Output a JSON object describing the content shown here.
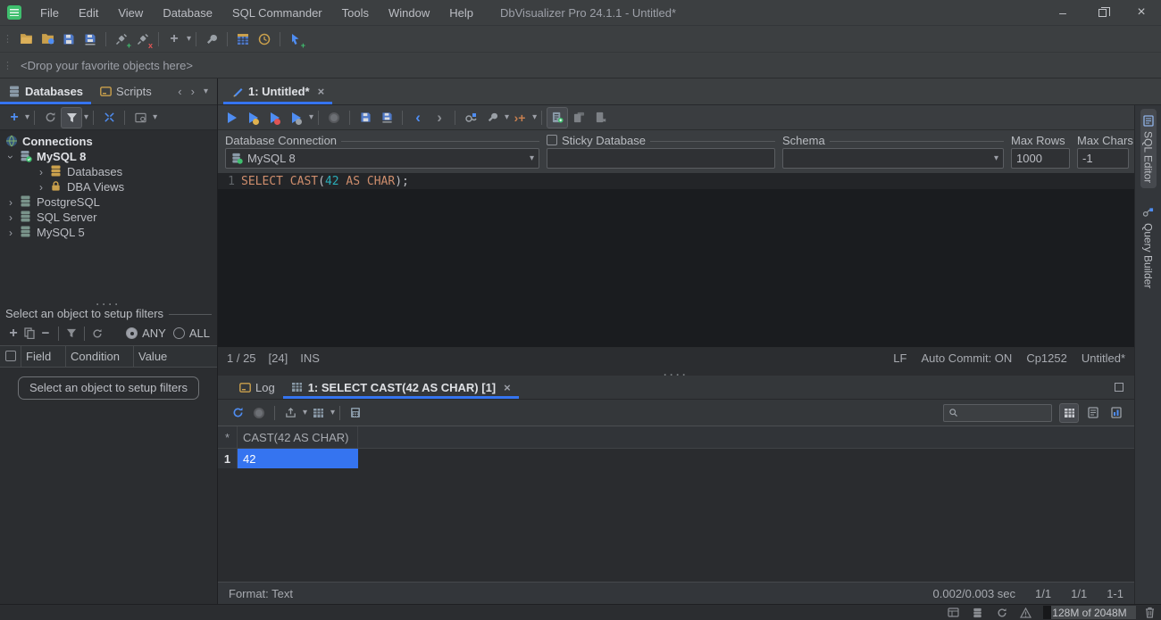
{
  "window": {
    "title": "DbVisualizer Pro 24.1.1 - Untitled*"
  },
  "menu": {
    "items": [
      "File",
      "Edit",
      "View",
      "Database",
      "SQL Commander",
      "Tools",
      "Window",
      "Help"
    ]
  },
  "favorites": {
    "placeholder": "<Drop your favorite objects here>"
  },
  "sidebar": {
    "tabs": {
      "databases": "Databases",
      "scripts": "Scripts"
    },
    "tree": {
      "root": "Connections",
      "mysql8": "MySQL 8",
      "databases": "Databases",
      "dba_views": "DBA Views",
      "postgresql": "PostgreSQL",
      "sqlserver": "SQL Server",
      "mysql5": "MySQL 5"
    },
    "filters": {
      "header": "Select an object to setup filters",
      "any": "ANY",
      "all": "ALL",
      "col_field": "Field",
      "col_condition": "Condition",
      "col_value": "Value",
      "button": "Select an object to setup filters"
    }
  },
  "editor": {
    "tab": "1: Untitled*",
    "connection": {
      "label": "Database Connection",
      "value": "MySQL 8"
    },
    "sticky": {
      "label": "Sticky Database"
    },
    "schema": {
      "label": "Schema"
    },
    "max_rows": {
      "label": "Max Rows",
      "value": "1000"
    },
    "max_chars": {
      "label": "Max Chars",
      "value": "-1"
    },
    "gutter": {
      "line1": "1"
    },
    "sql": {
      "kw1": "SELECT ",
      "fn": "CAST",
      "p1": "(",
      "num": "42",
      "kw2": " AS ",
      "kw3": "CHAR",
      "p2": ");"
    },
    "status": {
      "caret": "1 / 25",
      "sel": "[24]",
      "mode": "INS",
      "eol": "LF",
      "autocommit": "Auto Commit: ON",
      "encoding": "Cp1252",
      "doc": "Untitled*"
    }
  },
  "right_tabs": {
    "sql_editor": "SQL Editor",
    "query_builder": "Query Builder"
  },
  "results": {
    "log_tab": "Log",
    "result_tab": "1: SELECT CAST(42 AS CHAR) [1]",
    "grid": {
      "corner": "*",
      "col1": "CAST(42 AS CHAR)",
      "row1_num": "1",
      "row1_val": "42"
    },
    "status": {
      "format": "Format: Text",
      "timing": "0.002/0.003 sec",
      "fraction1": "1/1",
      "fraction2": "1/1",
      "range": "1-1"
    }
  },
  "statusbar": {
    "memory": "128M of 2048M"
  }
}
